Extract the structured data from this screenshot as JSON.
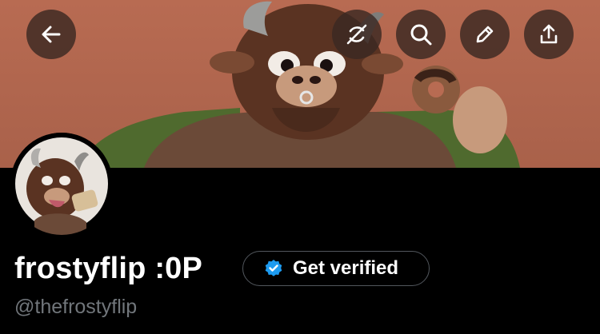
{
  "header": {
    "back_icon": "arrow-left-icon",
    "actions": [
      {
        "icon": "no-sync-icon"
      },
      {
        "icon": "search-icon"
      },
      {
        "icon": "pencil-icon"
      },
      {
        "icon": "share-upload-icon"
      }
    ],
    "banner_colors": {
      "background": "#b86b52",
      "fur": "#5a3322",
      "couch": "#4f6a2e"
    }
  },
  "profile": {
    "display_name": "frostyflip :0P",
    "handle": "@thefrostyflip",
    "verify_label": "Get verified",
    "verify_badge_color": "#1d9bf0"
  }
}
